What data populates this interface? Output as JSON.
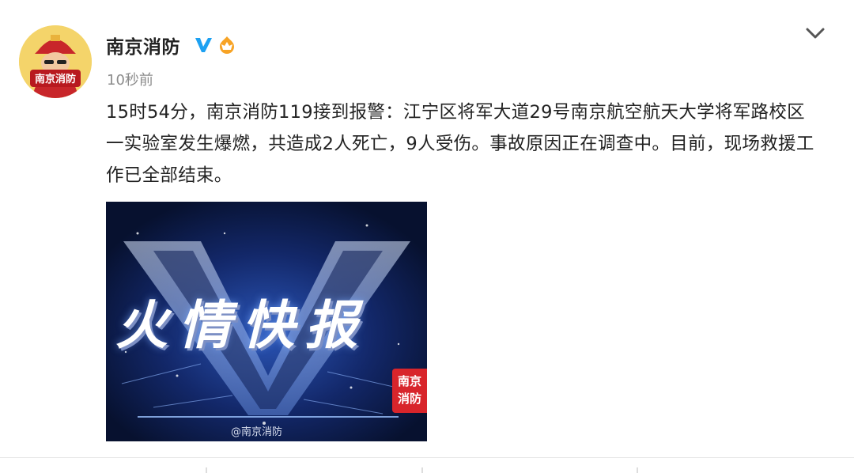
{
  "author": {
    "name": "南京消防",
    "avatar_text": "南京消防",
    "verified_icon": "verified-v-icon",
    "badge_icon": "orange-fire-badge-icon"
  },
  "post": {
    "time": "10秒前",
    "text": "15时54分，南京消防119接到报警：江宁区将军大道29号南京航空航天大学将军路校区一实验室发生爆燃，共造成2人死亡，9人受伤。事故原因正在调查中。目前，现场救援工作已全部结束。"
  },
  "image": {
    "title": "火情快报",
    "stamp_line1": "南京",
    "stamp_line2": "消防",
    "watermark": "@南京消防"
  },
  "menu_icon": "chevron-down-icon",
  "colors": {
    "verified": "#1da1f2",
    "badge": "#f7a325",
    "image_background": "#0b1840",
    "stamp": "#d8252b"
  }
}
